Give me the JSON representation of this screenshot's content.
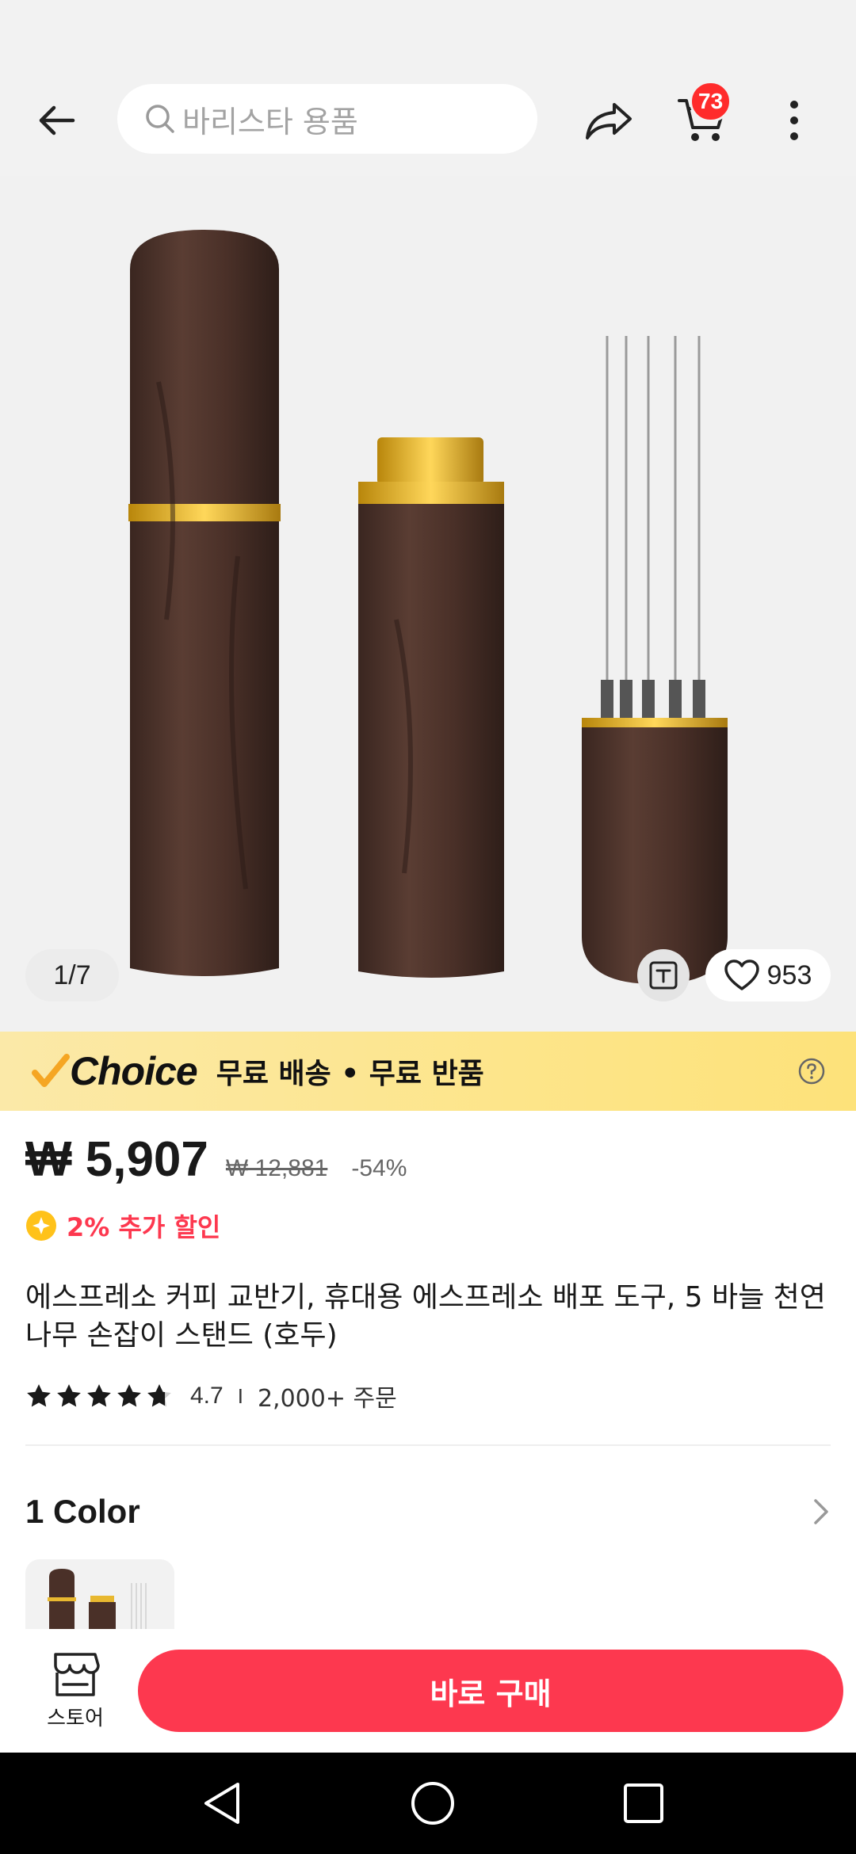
{
  "header": {
    "search_placeholder": "바리스타 용품",
    "cart_count": "73",
    "icons": [
      "back-arrow-icon",
      "search-icon",
      "share-icon",
      "cart-icon",
      "more-vertical-icon"
    ]
  },
  "gallery": {
    "page_indicator": "1/7",
    "wishlist_count": "953",
    "icons": [
      "translate-icon",
      "heart-icon"
    ]
  },
  "choice_banner": {
    "logo_text": "Choice",
    "text": "무료 배송 • 무료 반품",
    "accent_color": "#f5a623"
  },
  "pricing": {
    "price": "₩ 5,907",
    "original_price": "₩ 12,881",
    "discount": "-54%",
    "extra_discount": "2% 추가 할인",
    "accent_color": "#fd384f"
  },
  "product": {
    "title": "에스프레소 커피 교반기, 휴대용 에스프레소 배포 도구, 5 바늘 천연 나무 손잡이 스탠드 (호두)",
    "rating": "4.7",
    "rating_separator": "I",
    "orders": "2,000+ 주문",
    "stars_value": 4.7
  },
  "variants": {
    "label": "1 Color"
  },
  "bottom_bar": {
    "store_label": "스토어",
    "buy_label": "바로 구매"
  }
}
